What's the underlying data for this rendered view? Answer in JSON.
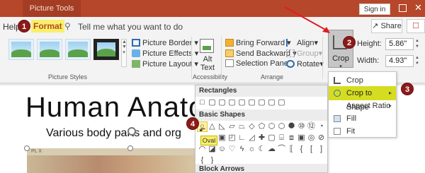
{
  "titlebar": {
    "context_tab": "Picture Tools",
    "signin_label": "Sign in",
    "close_glyph": "✕"
  },
  "tabs": {
    "help": "Help",
    "format": "Format",
    "tell_me": "Tell me what you want to do",
    "share": "Share",
    "comment_glyph": "☐"
  },
  "ribbon": {
    "picture_styles": {
      "group_label": "Picture Styles",
      "picture_border": "Picture Border",
      "picture_effects": "Picture Effects",
      "picture_layout": "Picture Layout"
    },
    "accessibility": {
      "group_label": "Accessibility",
      "alt_text_line1": "Alt",
      "alt_text_line2": "Text"
    },
    "arrange": {
      "group_label": "Arrange",
      "bring_forward": "Bring Forward",
      "send_backward": "Send Backward",
      "selection_pane": "Selection Pane",
      "align": "Align",
      "group": "Group",
      "rotate": "Rotate"
    },
    "size": {
      "crop_label": "Crop",
      "height_label": "Height:",
      "height_value": "5.86\"",
      "width_label": "Width:",
      "width_value": "4.93\""
    }
  },
  "slide": {
    "title": "Human Anato",
    "subtitle": "Various body parts and org",
    "picture_caption": "PL X"
  },
  "shapes_panel": {
    "rectangles_header": "Rectangles",
    "basic_shapes_header": "Basic Shapes",
    "block_arrows_header": "Block Arrows",
    "tooltip": "Oval"
  },
  "crop_menu": {
    "items": [
      {
        "label": "Crop"
      },
      {
        "label": "Crop to Shape"
      },
      {
        "label": "Aspect Ratio"
      },
      {
        "label": "Fill"
      },
      {
        "label": "Fit"
      }
    ]
  },
  "annotations": {
    "step1": "1",
    "step2": "2",
    "step3": "3",
    "step4": "4",
    "color": "#8b1a1a"
  },
  "colors": {
    "brand": "#b7472a",
    "highlight": "#d6dd21",
    "tooltip": "#f8f06a"
  }
}
